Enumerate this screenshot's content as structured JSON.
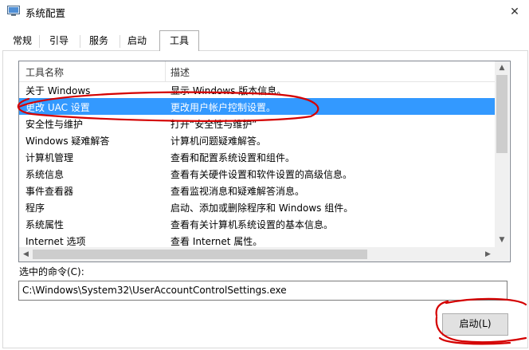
{
  "window": {
    "title": "系统配置",
    "close_glyph": "✕"
  },
  "tabs": [
    {
      "label": "常规",
      "active": false
    },
    {
      "label": "引导",
      "active": false
    },
    {
      "label": "服务",
      "active": false
    },
    {
      "label": "启动",
      "active": false
    },
    {
      "label": "工具",
      "active": true
    }
  ],
  "tools_list": {
    "columns": [
      "工具名称",
      "描述"
    ],
    "rows": [
      {
        "name": "关于 Windows",
        "description": "显示 Windows 版本信息。"
      },
      {
        "name": "更改 UAC 设置",
        "description": "更改用户帐户控制设置。",
        "selected": true
      },
      {
        "name": "安全性与维护",
        "description": "打开“安全性与维护”"
      },
      {
        "name": "Windows 疑难解答",
        "description": "计算机问题疑难解答。"
      },
      {
        "name": "计算机管理",
        "description": "查看和配置系统设置和组件。"
      },
      {
        "name": "系统信息",
        "description": "查看有关硬件设置和软件设置的高级信息。"
      },
      {
        "name": "事件查看器",
        "description": "查看监视消息和疑难解答消息。"
      },
      {
        "name": "程序",
        "description": "启动、添加或删除程序和 Windows 组件。"
      },
      {
        "name": "系统属性",
        "description": "查看有关计算机系统设置的基本信息。"
      },
      {
        "name": "Internet 选项",
        "description": "查看 Internet 属性。"
      }
    ]
  },
  "selected_command": {
    "label": "选中的命令(C):",
    "value": "C:\\Windows\\System32\\UserAccountControlSettings.exe"
  },
  "launch_button": {
    "label": "启动(L)"
  },
  "icons": {
    "app": "system-config-icon",
    "close": "close-icon",
    "scroll_up": "scroll-up-arrow-icon",
    "scroll_down": "scroll-down-arrow-icon",
    "scroll_left": "scroll-left-arrow-icon",
    "scroll_right": "scroll-right-arrow-icon"
  },
  "colors": {
    "selection": "#3399ff",
    "annotation_ink": "#d40000",
    "button_face": "#e1e1e1"
  }
}
